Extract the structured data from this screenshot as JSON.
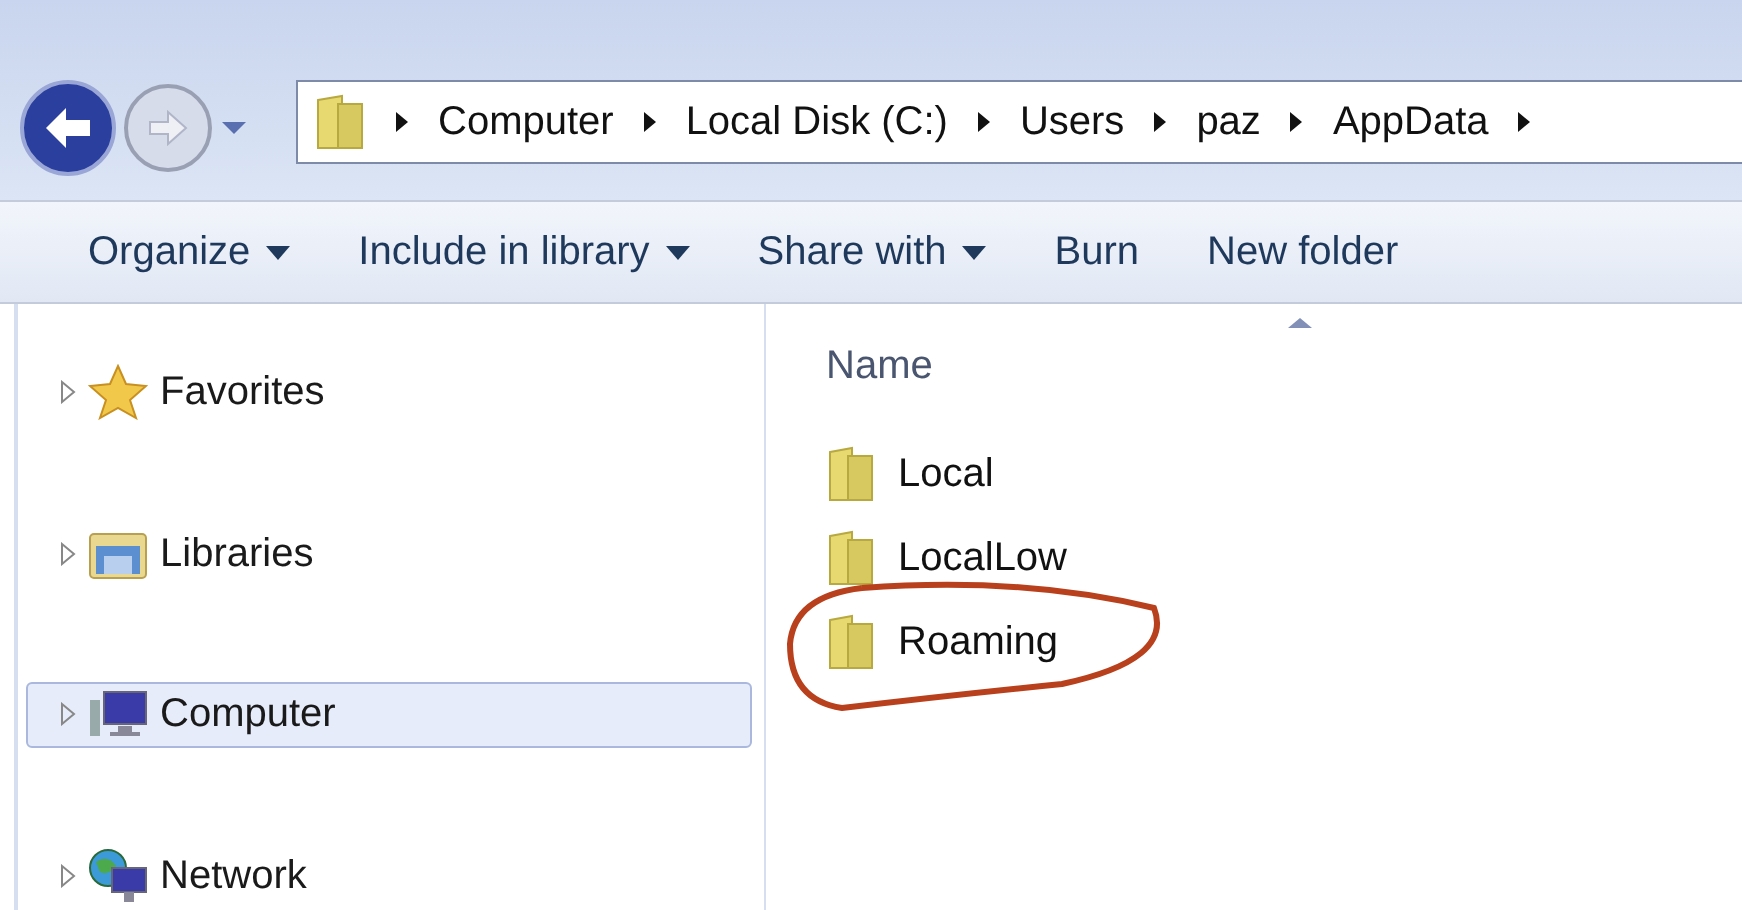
{
  "breadcrumb": [
    "Computer",
    "Local Disk (C:)",
    "Users",
    "paz",
    "AppData"
  ],
  "toolbar": [
    {
      "label": "Organize",
      "dropdown": true
    },
    {
      "label": "Include in library",
      "dropdown": true
    },
    {
      "label": "Share with",
      "dropdown": true
    },
    {
      "label": "Burn",
      "dropdown": false
    },
    {
      "label": "New folder",
      "dropdown": false
    }
  ],
  "navigation": [
    {
      "label": "Favorites",
      "kind": "star",
      "selected": false
    },
    {
      "label": "Libraries",
      "kind": "library",
      "selected": false
    },
    {
      "label": "Computer",
      "kind": "computer",
      "selected": true
    },
    {
      "label": "Network",
      "kind": "network",
      "selected": false
    }
  ],
  "column_header": "Name",
  "files": [
    {
      "name": "Local",
      "circled": false
    },
    {
      "name": "LocalLow",
      "circled": false
    },
    {
      "name": "Roaming",
      "circled": true
    }
  ]
}
